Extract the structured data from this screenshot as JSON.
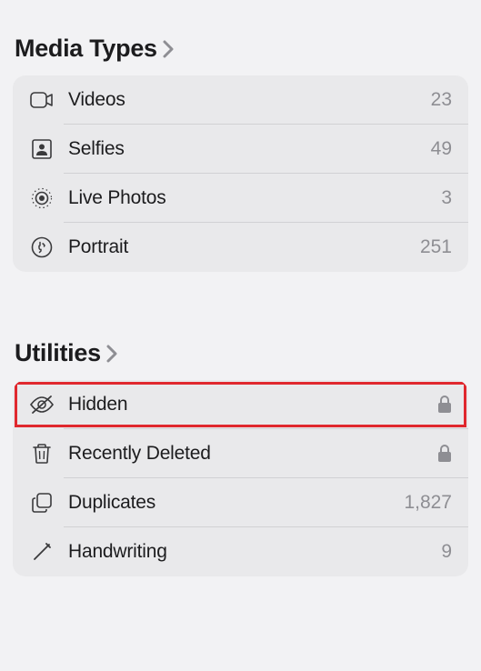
{
  "mediaTypes": {
    "title": "Media Types",
    "items": [
      {
        "label": "Videos",
        "count": "23"
      },
      {
        "label": "Selfies",
        "count": "49"
      },
      {
        "label": "Live Photos",
        "count": "3"
      },
      {
        "label": "Portrait",
        "count": "251"
      }
    ]
  },
  "utilities": {
    "title": "Utilities",
    "items": [
      {
        "label": "Hidden"
      },
      {
        "label": "Recently Deleted"
      },
      {
        "label": "Duplicates",
        "count": "1,827"
      },
      {
        "label": "Handwriting",
        "count": "9"
      }
    ]
  }
}
